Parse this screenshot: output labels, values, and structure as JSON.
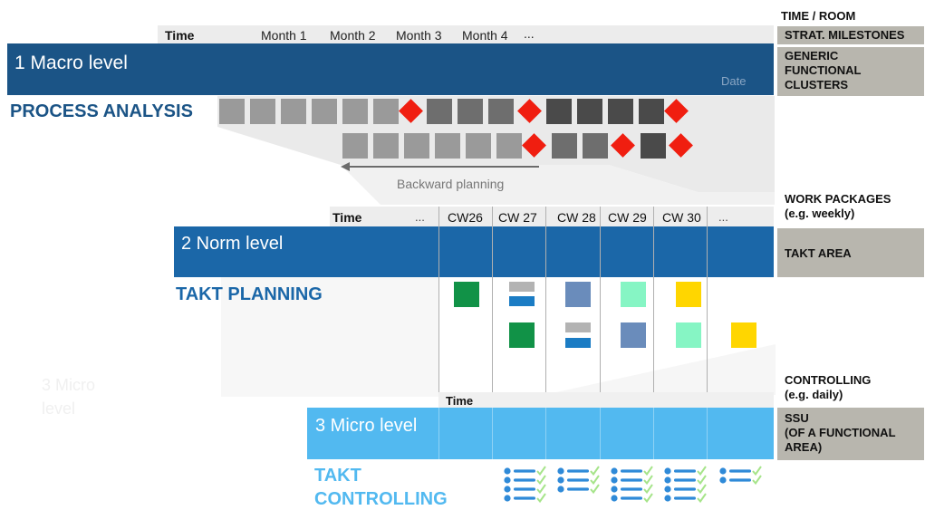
{
  "macro": {
    "time_label": "Time",
    "months": [
      "Month 1",
      "Month 2",
      "Month 3",
      "Month 4",
      "..."
    ],
    "band_label": "1 Macro level",
    "date_label": "Date",
    "section_title": "PROCESS ANALYSIS",
    "backward_label": "Backward planning",
    "band_color": "#1b5486",
    "title_color": "#1b5486"
  },
  "norm": {
    "time_label": "Time",
    "ellipsis_left": "...",
    "weeks": [
      "CW26",
      "CW 27",
      "CW 28",
      "CW 29",
      "CW 30",
      "..."
    ],
    "band_label": "2 Norm level",
    "section_title": "TAKT PLANNING",
    "band_color": "#1b67a8"
  },
  "micro": {
    "time_label": "Time",
    "band_label": "3 Micro level",
    "faint_label": "3 Micro level",
    "section_title_1": "TAKT",
    "section_title_2": "CONTROLLING",
    "band_color": "#52b9f0"
  },
  "right_panel": {
    "time_room": "TIME / ROOM",
    "strat_milestones": "STRAT. MILESTONES",
    "generic_clusters": "GENERIC\nFUNCTIONAL\nCLUSTERS",
    "work_packages": "WORK PACKAGES\n(e.g. weekly)",
    "takt_area": "TAKT AREA",
    "controlling": "CONTROLLING\n(e.g. daily)",
    "ssu": "SSU\n(OF A FUNCTIONAL\nAREA)"
  },
  "colors": {
    "diamond": "#f01e10",
    "green": "#119247",
    "steel": "#6a8cbb",
    "mint": "#86f5c4",
    "yellow": "#ffd600",
    "grey_bar": "#b3b3b3",
    "blue_bar": "#1b7cc4",
    "check": "#a6e48a",
    "bullet": "#2f8ad8"
  }
}
